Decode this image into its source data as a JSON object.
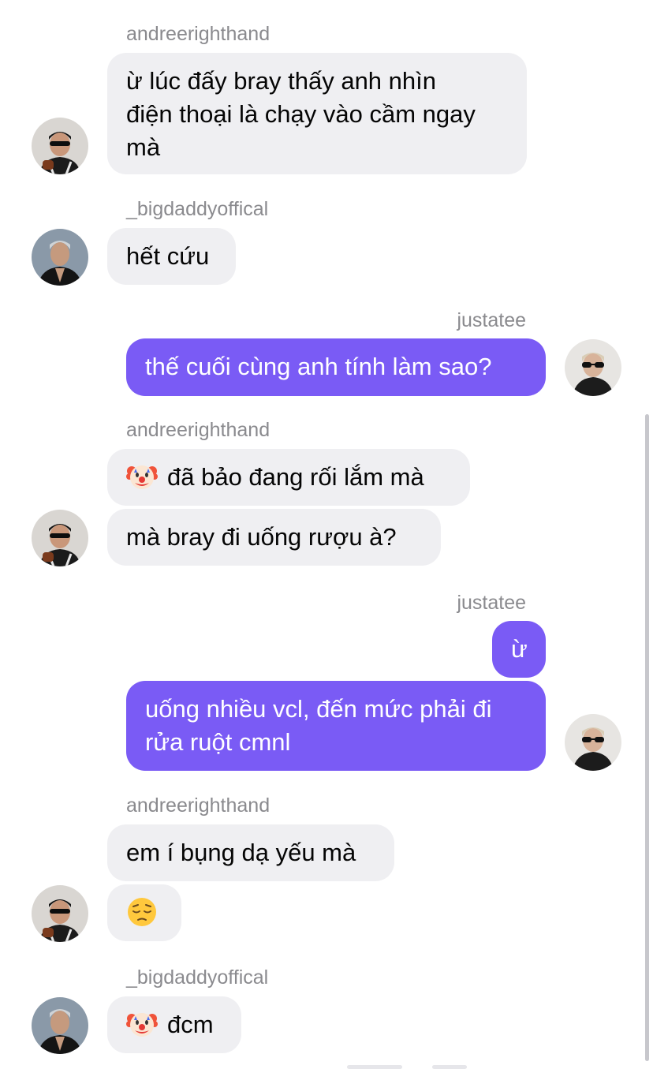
{
  "users": {
    "andree": "andreerighthand",
    "bigdaddy": "_bigdaddyoffical",
    "justatee": "justatee"
  },
  "avatars": {
    "andree": "avatar-andreerighthand",
    "bigdaddy": "avatar-bigdaddyoffical",
    "justatee": "avatar-justatee"
  },
  "messages": [
    {
      "sender": "andreerighthand",
      "lines": [
        "ừ lúc đấy bray thấy anh nhìn",
        "điện thoại là chạy vào cầm ngay",
        "mà"
      ]
    },
    {
      "sender": "_bigdaddyoffical",
      "text": "hết cứu"
    },
    {
      "sender": "justatee",
      "text": "thế cuối cùng anh tính làm sao?"
    },
    {
      "sender": "andreerighthand",
      "emoji": "clown-face",
      "text": "đã bảo đang rối lắm mà"
    },
    {
      "sender": "andreerighthand",
      "text": "mà bray đi uống rượu à?"
    },
    {
      "sender": "justatee",
      "text": "ừ"
    },
    {
      "sender": "justatee",
      "lines": [
        "uống nhiều vcl, đến mức phải đi",
        "rửa ruột cmnl"
      ]
    },
    {
      "sender": "andreerighthand",
      "text": "em í bụng dạ yếu mà"
    },
    {
      "sender": "andreerighthand",
      "emoji": "pensive-face"
    },
    {
      "sender": "_bigdaddyoffical",
      "emoji": "clown-face",
      "text": "đcm"
    }
  ],
  "colors": {
    "outgoing_bubble": "#7a5bf5",
    "incoming_bubble": "#efeff2",
    "sender_name": "#8a8a8e"
  }
}
